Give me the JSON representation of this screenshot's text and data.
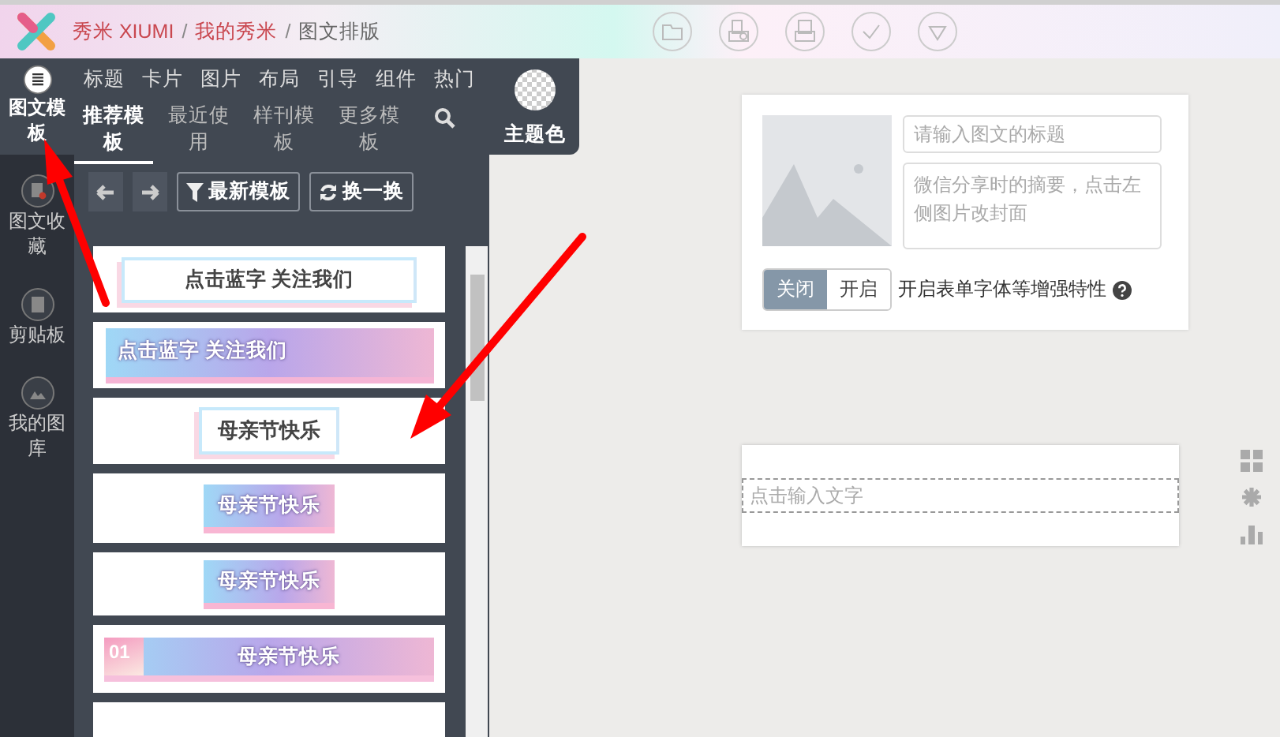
{
  "header": {
    "separator": "/",
    "breadcrumb": [
      {
        "label": "秀米 XIUMI",
        "link": true
      },
      {
        "label": "我的秀米",
        "link": true
      },
      {
        "label": "图文排版",
        "link": false
      }
    ]
  },
  "rail": [
    {
      "label": "图文模板",
      "selected": true,
      "kind": "template"
    },
    {
      "label": "图文收藏",
      "selected": false,
      "kind": "favorite"
    },
    {
      "label": "剪贴板",
      "selected": false,
      "kind": "clipboard"
    },
    {
      "label": "我的图库",
      "selected": false,
      "kind": "gallery"
    }
  ],
  "categories": [
    "标题",
    "卡片",
    "图片",
    "布局",
    "引导",
    "组件",
    "热门"
  ],
  "subtabs": [
    {
      "label": "推荐模板",
      "selected": true
    },
    {
      "label": "最近使用",
      "selected": false
    },
    {
      "label": "样刊模板",
      "selected": false
    },
    {
      "label": "更多模板",
      "selected": false
    }
  ],
  "theme": {
    "label": "主题色"
  },
  "buttons": [
    {
      "label": "最新模板",
      "kind": "filter"
    },
    {
      "label": "换一换",
      "kind": "refresh"
    }
  ],
  "templates": [
    {
      "kind": "outline",
      "text": "点击蓝字 关注我们"
    },
    {
      "kind": "banner",
      "text": "点击蓝字 关注我们"
    },
    {
      "kind": "outline-small",
      "text": "母亲节快乐"
    },
    {
      "kind": "block",
      "text": "母亲节快乐"
    },
    {
      "kind": "block-torn",
      "text": "母亲节快乐"
    },
    {
      "kind": "numbered",
      "number": "01",
      "text": "母亲节快乐"
    },
    {
      "kind": "banner-partial"
    }
  ],
  "article": {
    "title_placeholder": "请输入图文的标题",
    "summary_placeholder": "微信分享时的摘要，点击左侧图片改封面",
    "toggle": [
      {
        "label": "关闭",
        "selected": true
      },
      {
        "label": "开启",
        "selected": false
      }
    ],
    "toggle_label": "开启表单字体等增强特性"
  },
  "editor": {
    "placeholder": "点击输入文字"
  }
}
